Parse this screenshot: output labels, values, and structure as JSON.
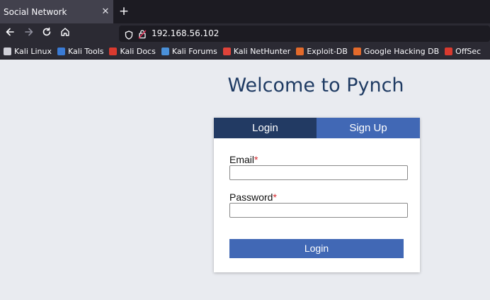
{
  "browser": {
    "tab_title": "Social Network",
    "tab_close": "✕",
    "new_tab": "+",
    "url": "192.168.56.102",
    "bookmarks": [
      {
        "label": "Kali Linux",
        "icon": "kali-dragon-icon",
        "color": "#d0d0d8"
      },
      {
        "label": "Kali Tools",
        "icon": "kali-tools-icon",
        "color": "#3a7bd5"
      },
      {
        "label": "Kali Docs",
        "icon": "kali-docs-icon",
        "color": "#d93a2f"
      },
      {
        "label": "Kali Forums",
        "icon": "kali-forums-icon",
        "color": "#4a90d9"
      },
      {
        "label": "Kali NetHunter",
        "icon": "kali-nethunter-icon",
        "color": "#e0433a"
      },
      {
        "label": "Exploit-DB",
        "icon": "exploit-db-icon",
        "color": "#e36a2b"
      },
      {
        "label": "Google Hacking DB",
        "icon": "ghdb-icon",
        "color": "#e36a2b"
      },
      {
        "label": "OffSec",
        "icon": "offsec-icon",
        "color": "#d93a2f"
      }
    ]
  },
  "page": {
    "heading": "Welcome to Pynch",
    "tabs": {
      "login": "Login",
      "signup": "Sign Up"
    },
    "form": {
      "email_label": "Email",
      "password_label": "Password",
      "required_mark": "*",
      "email_value": "",
      "password_value": "",
      "submit_label": "Login"
    }
  },
  "colors": {
    "accent_dark": "#223a63",
    "accent": "#4168b5",
    "heading": "#1f3b63",
    "required": "#d3262a"
  }
}
